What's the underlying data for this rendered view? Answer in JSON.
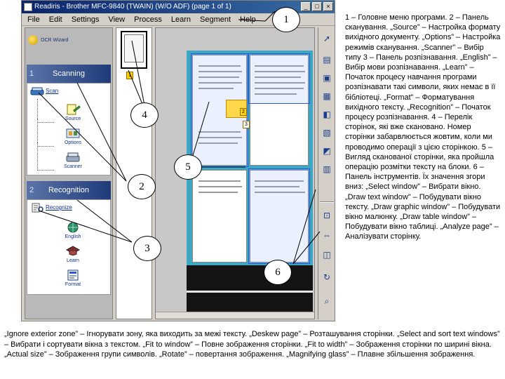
{
  "window": {
    "title": "Readiris - Brother MFC-9840 (TWAIN) (W/O ADF) (page 1 of 1)",
    "controls": [
      "_",
      "□",
      "×"
    ]
  },
  "menu": [
    "File",
    "Edit",
    "Settings",
    "View",
    "Process",
    "Learn",
    "Segment",
    "Help"
  ],
  "sidebar": {
    "wizard_label": "OCR Wizard",
    "steps": [
      {
        "number": "1",
        "title": "Scanning",
        "main_task": "Scan",
        "subitems": [
          "Source",
          "Options",
          "Scanner"
        ]
      },
      {
        "number": "2",
        "title": "Recognition",
        "main_task": "Recognize",
        "subitems": [
          "English",
          "Learn",
          "Format"
        ]
      }
    ]
  },
  "pagelist": {
    "badge": "1"
  },
  "image_pane": {
    "zone_badges": [
      "2",
      "3"
    ]
  },
  "toolbar": {
    "icons": [
      "select-window-icon",
      "draw-text-window-icon",
      "draw-graphic-window-icon",
      "draw-table-window-icon",
      "analyze-page-icon",
      "ignore-exterior-zone-icon",
      "deskew-page-icon",
      "select-and-sort-windows-icon",
      "fit-to-window-icon",
      "fit-to-width-icon",
      "actual-size-icon",
      "rotate-icon",
      "magnifying-glass-icon"
    ]
  },
  "callouts": [
    "1",
    "2",
    "3",
    "4",
    "5",
    "6"
  ],
  "description": {
    "legend": "1 – Головне меню програми. 2 – Панель сканування. „Source” – Настройка формату вихідного документу. „Options” – Настройка режимів сканування. „Scanner” – Вибір типу 3 – Панель розпізнавання. „English” – Вибір мови розпізнавання. „Learn” – Початок процесу навчання програми розпізнавати такі символи, яких немає в її бібліотеці. „Format” – Форматування вихідного тексту. „Recognition” – Початок процесу розпізнавання. 4 – Перелік сторінок, які вже скановано. Номер сторінки забарвлюється жовтим, коли ми проводимо операції з цією сторінкою. 5 – Вигляд сканованої сторінки, яка пройшла операцію розмітки тексту на блоки. 6 – Панель інструментів. Їх значення згори вниз: „Select window” – Вибрати вікно. „Draw text window” – Побудувати вікно тексту. „Draw graphic window” – Побудувати вікно малюнку. „Draw table window” – Побудувати вікно таблиці. „Analyze page” – Аналізувати сторінку.",
    "bottom": "„Ignore exterior zone” – Ігнорувати зону, яка виходить за межі тексту. „Deskew page” – Розташування сторінки. „Select and sort text windows” – Вибрати і сортувати вікна з текстом. „Fit to window” – Повне зображення сторінки. „Fit to width” – Зображення сторінки по ширині вікна. „Actual size” – Зображення групи символів. „Rotate” – повертання зображення. „Magnifying glass” – Плавне збільшення зображення."
  },
  "colors": {
    "titlebar": "#0a246a",
    "step_header": "#1f3b78",
    "scan_background": "#3ea5c2",
    "zone_outline": "#2f58d8",
    "active_page_badge": "#ffd200"
  }
}
